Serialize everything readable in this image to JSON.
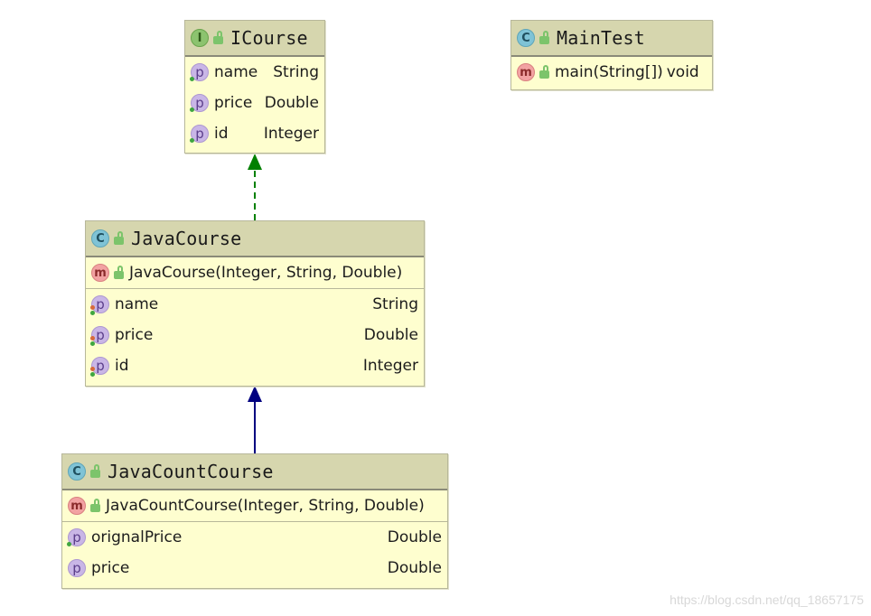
{
  "classes": {
    "icourse": {
      "name": "ICourse",
      "fields": [
        {
          "name": "name",
          "type": "String"
        },
        {
          "name": "price",
          "type": "Double"
        },
        {
          "name": "id",
          "type": "Integer"
        }
      ]
    },
    "maintest": {
      "name": "MainTest",
      "methods": [
        {
          "signature": "main(String[])",
          "type": "void"
        }
      ]
    },
    "javacourse": {
      "name": "JavaCourse",
      "methods": [
        {
          "signature": "JavaCourse(Integer, String, Double)"
        }
      ],
      "fields": [
        {
          "name": "name",
          "type": "String"
        },
        {
          "name": "price",
          "type": "Double"
        },
        {
          "name": "id",
          "type": "Integer"
        }
      ]
    },
    "javacountcourse": {
      "name": "JavaCountCourse",
      "methods": [
        {
          "signature": "JavaCountCourse(Integer, String, Double)"
        }
      ],
      "fields": [
        {
          "name": "orignalPrice",
          "type": "Double"
        },
        {
          "name": "price",
          "type": "Double"
        }
      ]
    }
  },
  "badges": {
    "interface": "I",
    "class": "C",
    "method": "m",
    "property": "p"
  },
  "icons": [
    "interface-icon",
    "class-icon",
    "method-icon",
    "property-icon",
    "public-lock-icon"
  ],
  "colors": {
    "header": "#d6d6ae",
    "body": "#fefecf",
    "implements_arrow": "#008000",
    "extends_arrow": "#000080"
  },
  "relations": [
    {
      "from": "JavaCourse",
      "to": "ICourse",
      "kind": "implements"
    },
    {
      "from": "JavaCountCourse",
      "to": "JavaCourse",
      "kind": "extends"
    }
  ],
  "watermark": "https://blog.csdn.net/qq_18657175"
}
